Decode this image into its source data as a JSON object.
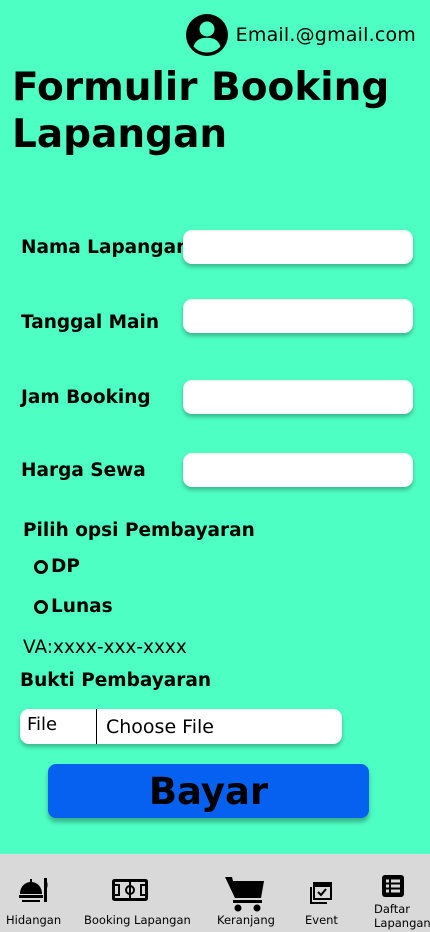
{
  "header": {
    "email": "Email.@gmail.com",
    "avatar_icon": "account-circle-icon"
  },
  "page": {
    "title": "Formulir Booking Lapangan"
  },
  "form": {
    "fields": [
      {
        "label": "Nama Lapangan",
        "value": ""
      },
      {
        "label": "Tanggal Main",
        "value": ""
      },
      {
        "label": "Jam Booking",
        "value": ""
      },
      {
        "label": "Harga Sewa",
        "value": ""
      }
    ],
    "payment_section_label": "Pilih opsi Pembayaran",
    "payment_options": [
      {
        "label": "DP",
        "selected": false
      },
      {
        "label": "Lunas",
        "selected": false
      }
    ],
    "va_text": "VA:xxxx-xxx-xxxx",
    "proof_label": "Bukti Pembayaran",
    "file_tag": "File",
    "file_choose_label": "Choose File",
    "submit_label": "Bayar"
  },
  "nav": {
    "items": [
      {
        "label": "Hidangan",
        "icon": "dining-icon"
      },
      {
        "label": "Booking Lapangan",
        "icon": "stadium-icon"
      },
      {
        "label": "Keranjang",
        "icon": "cart-icon"
      },
      {
        "label": "Event",
        "icon": "event-calendar-icon"
      },
      {
        "label": "Daftar Lapangan",
        "icon": "list-icon"
      }
    ]
  },
  "colors": {
    "background": "#4dffc3",
    "primary_button": "#0761f0",
    "nav_background": "#d9d9d9"
  }
}
